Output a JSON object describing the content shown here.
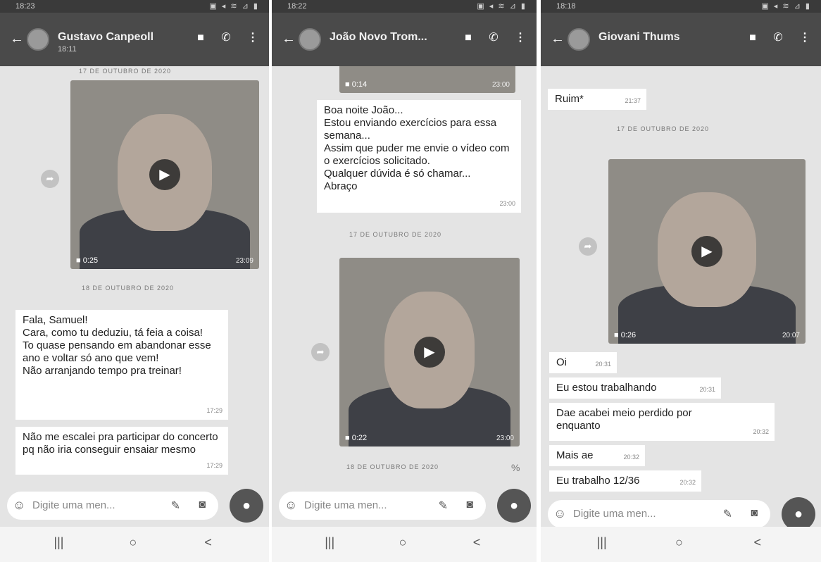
{
  "ui": {
    "placeholder": "Digite uma men...",
    "nav": [
      "|||",
      "○",
      "<"
    ]
  },
  "p1": {
    "time": "18:23",
    "icons": "▣ ◂ ≋ ⊿ ▮",
    "name": "Gustavo Canpeoll",
    "sub": "18:11",
    "date_top": "17 DE OUTUBRO DE 2020",
    "video": {
      "duration": "0:25",
      "time": "23:09"
    },
    "date": "18 DE OUTUBRO DE 2020",
    "msg1": {
      "text": "Fala, Samuel!\nCara, como tu deduziu, tá feia a coisa!\nTo quase pensando em abandonar esse ano e voltar só ano que vem!\nNão arranjando tempo pra treinar!",
      "time": "17:29"
    },
    "msg2": {
      "text": "Não me escalei pra participar do concerto pq não iria conseguir ensaiar mesmo",
      "time": "17:29"
    }
  },
  "p2": {
    "time": "18:22",
    "icons": "▣ ◂ ≋ ⊿ ▮",
    "name": "João Novo Trom...",
    "video_top": {
      "duration": "0:14",
      "time": "23:00"
    },
    "msg1": {
      "text": "Boa noite João...\nEstou enviando exercícios para essa semana...\nAssim que puder me envie o vídeo com o exercícios solicitado.\nQualquer dúvida é só chamar...\nAbraço",
      "time": "23:00"
    },
    "date": "17 DE OUTUBRO DE 2020",
    "video": {
      "duration": "0:22",
      "time": "23:00"
    },
    "date2": "18 DE OUTUBRO DE 2020",
    "mark": "%"
  },
  "p3": {
    "time": "18:18",
    "icons": "▣ ◂ ≋ ⊿ ▮",
    "name": "Giovani Thums",
    "msg0": {
      "text": "Ruim*",
      "time": "21:37"
    },
    "date": "17 DE OUTUBRO DE 2020",
    "video": {
      "duration": "0:26",
      "time": "20:07"
    },
    "msgs": [
      {
        "text": "Oi",
        "time": "20:31"
      },
      {
        "text": "Eu estou trabalhando",
        "time": "20:31"
      },
      {
        "text": "Dae acabei meio perdido por enquanto",
        "time": "20:32"
      },
      {
        "text": "Mais ae",
        "time": "20:32"
      },
      {
        "text": "Eu trabalho 12/36",
        "time": "20:32"
      }
    ]
  }
}
